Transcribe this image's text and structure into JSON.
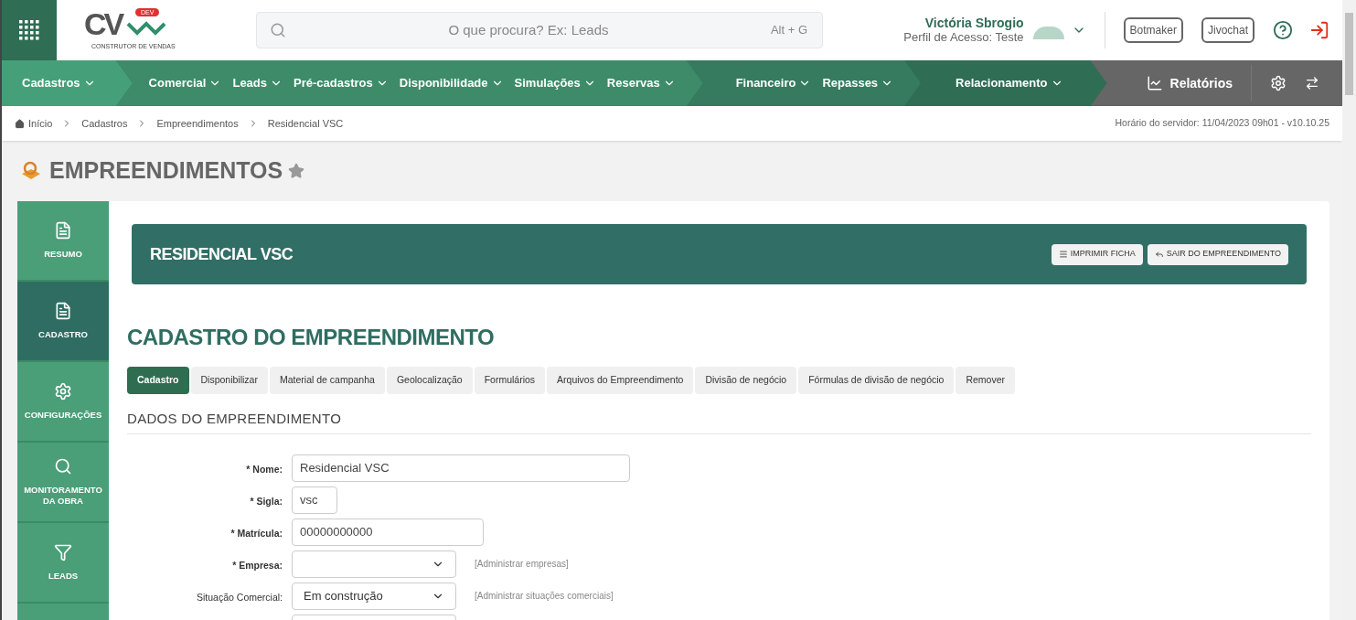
{
  "header": {
    "logo": {
      "letters": "CV",
      "badge": "DEV",
      "tagline": "CONSTRUTOR DE VENDAS"
    },
    "search": {
      "placeholder": "O que procura? Ex: Leads",
      "shortcut": "Alt + G"
    },
    "user": {
      "name": "Victória Sbrogio",
      "profile": "Perfil de Acesso: Teste"
    },
    "buttons": [
      "Botmaker",
      "Jivochat"
    ]
  },
  "nav": {
    "groups": [
      {
        "color": "#45a079",
        "items": [
          "Cadastros"
        ]
      },
      {
        "color": "#3d8b69",
        "items": [
          "Comercial",
          "Leads",
          "Pré-cadastros",
          "Disponibilidade",
          "Simulações",
          "Reservas"
        ]
      },
      {
        "color": "#367b5f",
        "items": [
          "Financeiro",
          "Repasses"
        ]
      },
      {
        "color": "#2f6d55",
        "items": [
          "Relacionamento"
        ]
      }
    ],
    "reports": "Relatórios"
  },
  "breadcrumb": [
    "Início",
    "Cadastros",
    "Empreendimentos",
    "Residencial VSC"
  ],
  "server_time": "Horário do servidor: 11/04/2023 09h01 - v10.10.25",
  "page_title": "EMPREENDIMENTOS",
  "sidebar": {
    "items": [
      {
        "kind": "file",
        "label": "RESUMO",
        "selected": false
      },
      {
        "kind": "file",
        "label": "CADASTRO",
        "selected": true
      },
      {
        "kind": "gear",
        "label": "CONFIGURAÇÕES",
        "selected": false
      },
      {
        "kind": "search",
        "label": "MONITORAMENTO DA OBRA",
        "selected": false
      },
      {
        "kind": "filter",
        "label": "LEADS",
        "selected": false
      }
    ]
  },
  "banner": {
    "title": "RESIDENCIAL VSC",
    "buttons": [
      {
        "kind": "print",
        "label": "IMPRIMIR FICHA"
      },
      {
        "kind": "exit",
        "label": "SAIR DO EMPREENDIMENTO"
      }
    ]
  },
  "section_title": "CADASTRO DO EMPREENDIMENTO",
  "tabs": [
    {
      "label": "Cadastro",
      "selected": true
    },
    {
      "label": "Disponibilizar",
      "selected": false
    },
    {
      "label": "Material de campanha",
      "selected": false
    },
    {
      "label": "Geolocalização",
      "selected": false
    },
    {
      "label": "Formulários",
      "selected": false
    },
    {
      "label": "Arquivos do Empreendimento",
      "selected": false
    },
    {
      "label": "Divisão de negócio",
      "selected": false
    },
    {
      "label": "Fórmulas de divisão de negócio",
      "selected": false
    },
    {
      "label": "Remover",
      "selected": false
    }
  ],
  "form": {
    "title": "DADOS DO EMPREENDIMENTO",
    "fields": [
      {
        "kind": "input",
        "label": "* Nome:",
        "required": true,
        "value": "Residencial VSC"
      },
      {
        "kind": "input",
        "label": "* Sigla:",
        "required": true,
        "value": "vsc"
      },
      {
        "kind": "input",
        "label": "* Matrícula:",
        "required": true,
        "value": "00000000000"
      },
      {
        "kind": "select",
        "label": "* Empresa:",
        "required": true,
        "link": "[Administrar empresas]"
      },
      {
        "kind": "select",
        "label": "Situação Comercial:",
        "required": false,
        "value": "Em construção",
        "link": "[Administrar situações comerciais]"
      },
      {
        "kind": "select"
      }
    ]
  }
}
